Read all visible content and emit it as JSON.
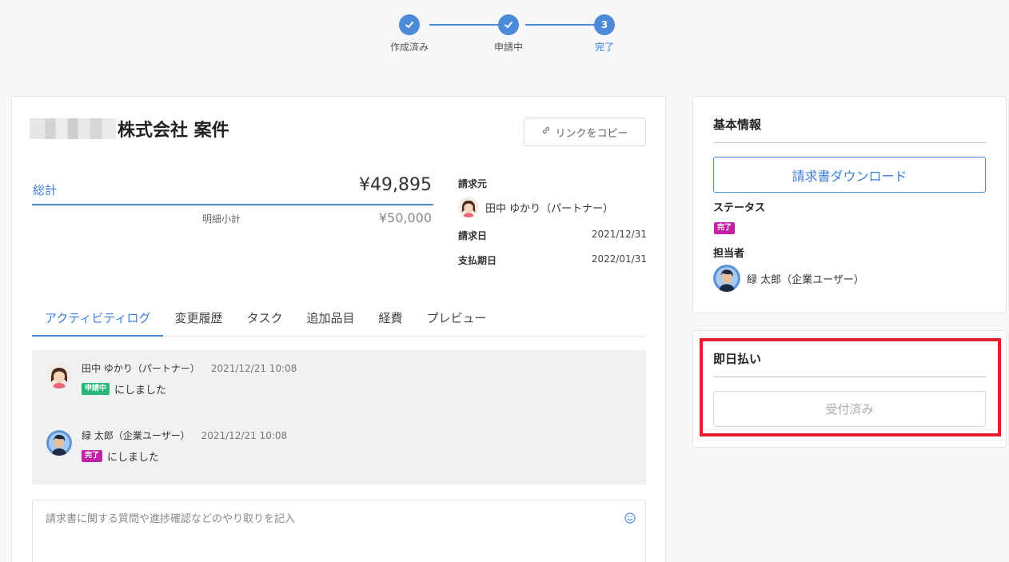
{
  "stepper": {
    "steps": [
      {
        "label": "作成済み",
        "state": "done"
      },
      {
        "label": "申請中",
        "state": "done"
      },
      {
        "label": "完了",
        "state": "current",
        "number": "3"
      }
    ]
  },
  "project": {
    "title": "株式会社 案件",
    "copy_link_label": "リンクをコピー"
  },
  "totals": {
    "total_label": "総計",
    "total_value": "¥49,895",
    "subtotal_label": "明細小計",
    "subtotal_value": "¥50,000"
  },
  "meta": {
    "billing_from_label": "請求元",
    "billing_from_name": "田中 ゆかり（パートナー）",
    "invoice_date_label": "請求日",
    "invoice_date": "2021/12/31",
    "due_date_label": "支払期日",
    "due_date": "2022/01/31"
  },
  "tabs": [
    "アクティビティログ",
    "変更履歴",
    "タスク",
    "追加品目",
    "経費",
    "プレビュー"
  ],
  "activity": [
    {
      "user": "田中 ゆかり（パートナー）",
      "time": "2021/12/21 10:08",
      "badge": "申請中",
      "badge_color": "#2ab67a",
      "text": "にしました"
    },
    {
      "user": "緑 太郎（企業ユーザー）",
      "time": "2021/12/21 10:08",
      "badge": "完了",
      "badge_color": "#c221a6",
      "text": "にしました"
    }
  ],
  "comment": {
    "placeholder": "請求書に関する質問や進捗確認などのやり取りを記入"
  },
  "basic_info": {
    "title": "基本情報",
    "download_label": "請求書ダウンロード",
    "status_label": "ステータス",
    "status_badge": "完了",
    "assignee_label": "担当者",
    "assignee_name": "緑 太郎（企業ユーザー）"
  },
  "same_day_pay": {
    "title": "即日払い",
    "button_label": "受付済み"
  },
  "colors": {
    "accent": "#4a8ad8",
    "highlight": "#e0212d"
  }
}
